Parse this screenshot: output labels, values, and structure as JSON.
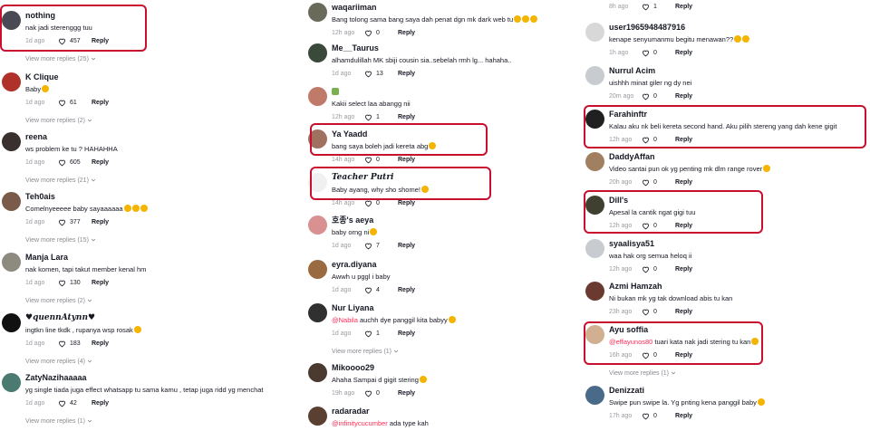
{
  "ui": {
    "reply_label": "Reply",
    "highlight_color": "#c8102e",
    "mention_color": "#fe2c55"
  },
  "col1": [
    {
      "user": "nothing",
      "text": "nak jadi sterenggg tuu",
      "date": "1d ago",
      "likes": "457",
      "more": "View more replies (25)",
      "av": "#4a4a55",
      "hl": true
    },
    {
      "user": "K Clique",
      "text": "Baby",
      "date": "1d ago",
      "likes": "61",
      "more": "View more replies (2)",
      "av": "#b0302a",
      "emo": 1
    },
    {
      "user": "reena",
      "text": "ws problem ke tu ? HAHAHHA",
      "date": "1d ago",
      "likes": "605",
      "more": "View more replies (21)",
      "av": "#3a3030"
    },
    {
      "user": "Teh0ais",
      "text": "Comelnyeeeee baby sayaaaaaa",
      "date": "1d ago",
      "likes": "377",
      "more": "View more replies (15)",
      "av": "#7a5a48",
      "emo": 3
    },
    {
      "user": "Manja Lara",
      "text": "nak komen, tapi takut member kenal hm",
      "date": "1d ago",
      "likes": "130",
      "more": "View more replies (2)",
      "av": "#8d8a80"
    },
    {
      "user": "♥quennAtynn♥",
      "text": "ingtkn line tkdk , rupanya wsp rosak",
      "date": "1d ago",
      "likes": "183",
      "more": "View more replies (4)",
      "av": "#111111",
      "script": true,
      "emo": 1
    },
    {
      "user": "ZatyNazihaaaaa",
      "text": "yg single tiada juga effect whatsapp tu sama kamu , tetap juga ridd yg menchat",
      "date": "1d ago",
      "likes": "42",
      "more": "View more replies (1)",
      "av": "#4a7a70"
    }
  ],
  "col2": [
    {
      "user": "waqariiman",
      "text": "Bang tolong sama bang saya dah penat dgn mk dark web tu",
      "date": "12h ago",
      "likes": "0",
      "av": "#6a6a5a",
      "emo": 3
    },
    {
      "user": "Me__Taurus",
      "text": "alhamdulillah MK sbiji cousin sia..sebelah rmh lg... hahaha..",
      "date": "1d ago",
      "likes": "13",
      "av": "#3a4a3a"
    },
    {
      "user": "",
      "text": "Kakii select laa abangg nii",
      "date": "12h ago",
      "likes": "1",
      "av": "#c07a6a",
      "badge": true
    },
    {
      "user": "Ya Yaadd",
      "text": "bang saya boleh jadi kereta abg",
      "date": "14h ago",
      "likes": "0",
      "av": "#a07060",
      "hl": true,
      "emo": 1
    },
    {
      "user": "Teacher Putri",
      "text": "Baby ayang, why sho shome!",
      "date": "14h ago",
      "likes": "0",
      "av": "#f0f0f0",
      "hl": true,
      "script": true,
      "emo": 1
    },
    {
      "user": "호종's aeya",
      "text": "baby orng ni",
      "date": "1d ago",
      "likes": "7",
      "av": "#d89090",
      "emo": 1
    },
    {
      "user": "eyra.diyana",
      "text": "Awwh u pggl i baby",
      "date": "1d ago",
      "likes": "4",
      "av": "#9a6a40"
    },
    {
      "user": "Nur Liyana",
      "mention": "@Nabila",
      "text": " auchh dye panggil kita babyy",
      "date": "1d ago",
      "likes": "1",
      "more": "View more replies (1)",
      "av": "#303030",
      "emo": 1
    },
    {
      "user": "Mikoooo29",
      "text": "Ahaha Sampai d gigit stering",
      "date": "19h ago",
      "likes": "0",
      "av": "#4a3a30",
      "emo": 1
    },
    {
      "user": "radaradar",
      "mention": "@infinitycucumber",
      "text": " ada type kah",
      "date": "",
      "likes": "",
      "av": "#5a4030"
    }
  ],
  "col3": [
    {
      "user": "",
      "text": "",
      "date": "8h ago",
      "likes": "1",
      "av": ""
    },
    {
      "user": "user1965948487916",
      "text": "kenape senyumanmu begitu menawan??",
      "date": "1h ago",
      "likes": "0",
      "av": "#d8d8d8",
      "emo": 2
    },
    {
      "user": "Nurrul Acim",
      "text": "uishhh minat giler ng dy nei",
      "date": "20m ago",
      "likes": "0",
      "av": "#c8ccd0"
    },
    {
      "user": "Farahinftr",
      "text": "Kalau aku nk beli kereta second hand. Aku pilih stereng yang dah kene gigit",
      "date": "12h ago",
      "likes": "0",
      "av": "#202020",
      "hl": true
    },
    {
      "user": "DaddyAffan",
      "text": "Video santai pun ok yg penting mk dlm range rover",
      "date": "20h ago",
      "likes": "0",
      "av": "#a08060",
      "emo": 1
    },
    {
      "user": "Dill's",
      "text": "Apesal la cantik ngat gigi tuu",
      "date": "12h ago",
      "likes": "0",
      "av": "#404030",
      "hl": true
    },
    {
      "user": "syaalisya51",
      "text": "waa hak org semua heloq ii",
      "date": "12h ago",
      "likes": "0",
      "av": "#c8ccd0"
    },
    {
      "user": "Azmi Hamzah",
      "text": "Ni bukan mk yg tak download abis tu kan",
      "date": "23h ago",
      "likes": "0",
      "av": "#6a3a30"
    },
    {
      "user": "Ayu soffia",
      "mention": "@effayunos80",
      "text": " tuari kata nak jadi stering tu kan",
      "date": "16h ago",
      "likes": "0",
      "more": "View more replies (1)",
      "av": "#d0b090",
      "hl": true,
      "emo": 1
    },
    {
      "user": "Denizzati",
      "text": "Swipe pun swipe la. Yg pnting kena panggil baby",
      "date": "17h ago",
      "likes": "0",
      "av": "#4a6a8a",
      "emo": 1
    }
  ]
}
